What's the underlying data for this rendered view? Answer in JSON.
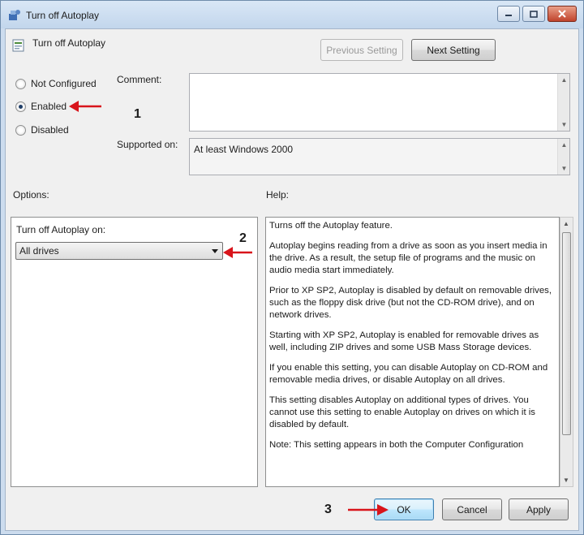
{
  "window": {
    "title": "Turn off Autoplay",
    "controls": [
      "minimize-icon",
      "maximize-icon",
      "close-icon"
    ]
  },
  "header": {
    "setting_name": "Turn off Autoplay",
    "previous_label": "Previous Setting",
    "next_label": "Next Setting"
  },
  "state": {
    "options": [
      {
        "label": "Not Configured",
        "selected": false
      },
      {
        "label": "Enabled",
        "selected": true
      },
      {
        "label": "Disabled",
        "selected": false
      }
    ]
  },
  "comment": {
    "label": "Comment:",
    "value": ""
  },
  "supported": {
    "label": "Supported on:",
    "value": "At least Windows 2000"
  },
  "options_pane": {
    "label": "Options:",
    "field_label": "Turn off Autoplay on:",
    "selected": "All drives"
  },
  "help_pane": {
    "label": "Help:",
    "paragraphs": [
      "Turns off the Autoplay feature.",
      "Autoplay begins reading from a drive as soon as you insert media in the drive. As a result, the setup file of programs and the music on audio media start immediately.",
      "Prior to XP SP2, Autoplay is disabled by default on removable drives, such as the floppy disk drive (but not the CD-ROM drive), and on network drives.",
      "Starting with XP SP2, Autoplay is enabled for removable drives as well, including ZIP drives and some USB Mass Storage devices.",
      "If you enable this setting, you can disable Autoplay on CD-ROM and removable media drives, or disable Autoplay on all drives.",
      "This setting disables Autoplay on additional types of drives. You cannot use this setting to enable Autoplay on drives on which it is disabled by default.",
      "Note: This setting appears in both the Computer Configuration"
    ]
  },
  "footer": {
    "ok_label": "OK",
    "cancel_label": "Cancel",
    "apply_label": "Apply"
  },
  "annotations": {
    "step1": "1",
    "step2": "2",
    "step3": "3",
    "arrow_color": "#d8141b"
  },
  "colors": {
    "title_bar": "#c8dcf0",
    "dialog_bg": "#f0f0f0",
    "accent": "#3c7fb1"
  }
}
